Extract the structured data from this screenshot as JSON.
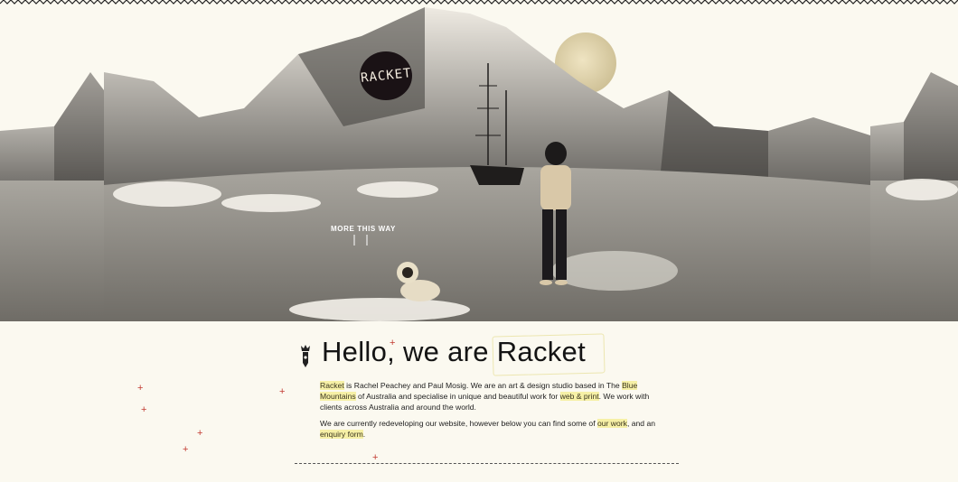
{
  "hero": {
    "logo_text": "RACKET",
    "more_this_way": "MORE THIS WAY"
  },
  "content": {
    "title": "Hello, we are Racket",
    "intro": {
      "racket": "Racket",
      "t1": " is Rachel Peachey and Paul Mosig. We are an art & design studio based in The ",
      "blue_mountains": "Blue Mountains",
      "t2": " of Australia and specialise in unique and beautiful work for ",
      "web_print": "web & print",
      "t3": ". We work with clients across Australia and around the world."
    },
    "redevelop": {
      "t1": "We are currently redeveloping our website, however below you can find some of ",
      "our_work": "our work",
      "t2": ", and an ",
      "enquiry_form": "enquiry form",
      "t3": "."
    }
  },
  "colors": {
    "background": "#fbf9f0",
    "highlight": "#f6f0a6",
    "accent_cross": "#c23b32",
    "text": "#141414"
  }
}
